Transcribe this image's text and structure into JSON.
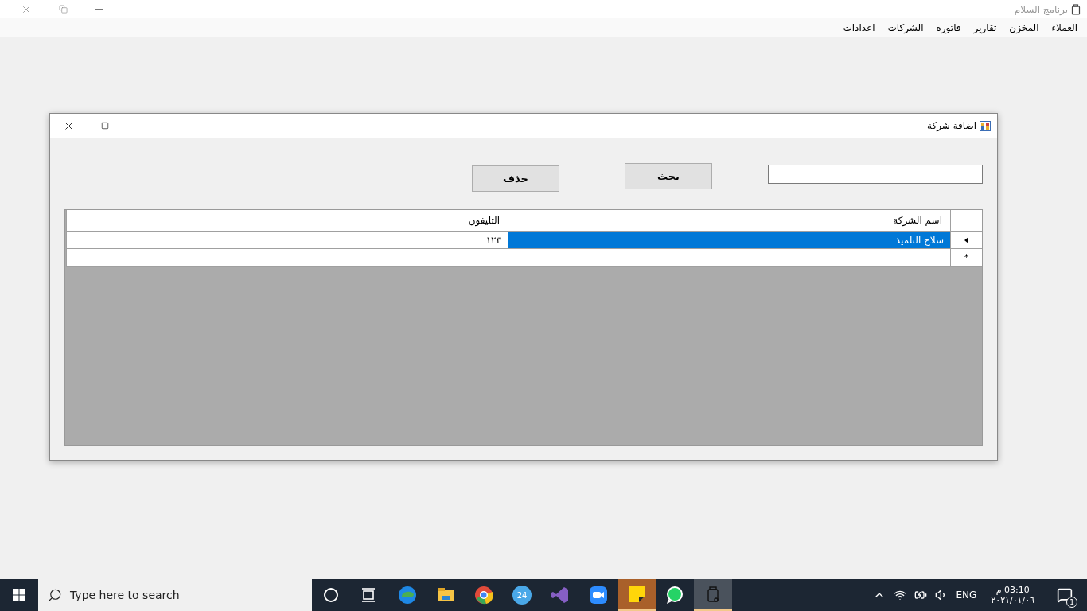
{
  "app_window": {
    "title": "برنامج السلام"
  },
  "menu": [
    {
      "label": "العملاء"
    },
    {
      "label": "المخزن"
    },
    {
      "label": "تقارير"
    },
    {
      "label": "فاتوره"
    },
    {
      "label": "الشركات"
    },
    {
      "label": "اعدادات"
    }
  ],
  "dialog": {
    "title": "اضافة شركة",
    "buttons": [
      {
        "label": "بحث",
        "kind": "search"
      },
      {
        "label": "حذف",
        "kind": "delete"
      }
    ],
    "grid": {
      "columns": [
        "اسم الشركة",
        "التليفون"
      ],
      "rows": [
        {
          "current": true,
          "cells": [
            {
              "text": "سلاح التلميذ",
              "selected": true
            },
            {
              "text": "١٢٣",
              "selected": false
            }
          ]
        }
      ],
      "new_row": {
        "marker": "*"
      }
    }
  },
  "taskbar": {
    "search": {
      "placeholder": "Type here to search"
    },
    "apps": [
      {
        "kind": "cortana",
        "active": false
      },
      {
        "kind": "taskview",
        "active": false
      },
      {
        "kind": "edge",
        "active": false
      },
      {
        "kind": "folder",
        "active": false
      },
      {
        "kind": "chrome",
        "active": false
      },
      {
        "kind": "calendar",
        "label": "24",
        "active": false
      },
      {
        "kind": "vs",
        "active": false
      },
      {
        "kind": "zoom",
        "active": false
      },
      {
        "kind": "sticky",
        "active": true
      },
      {
        "kind": "whatsapp",
        "active": false
      },
      {
        "kind": "app",
        "active": true
      }
    ],
    "language": "ENG",
    "time": "03:10 م",
    "date": "٢٠٢١/٠١/٠٦",
    "notifications": "1"
  }
}
